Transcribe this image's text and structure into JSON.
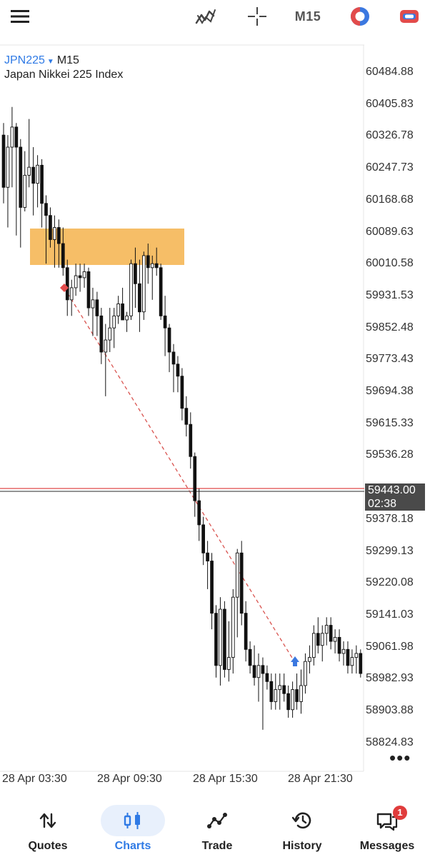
{
  "toolbar": {
    "timeframe": "M15",
    "icons": [
      "hamburger-menu-icon",
      "indicators-icon",
      "crosshair-icon",
      "one-click-trading-icon",
      "trade-toggle-icon"
    ]
  },
  "chart": {
    "symbol": "JPN225",
    "timeframe": "M15",
    "description": "Japan Nikkei 225 Index",
    "price_label": "59443.00",
    "countdown": "02:38",
    "more_label": "•••"
  },
  "colors": {
    "accent": "#2f7ae5",
    "zone": "#f5b95a",
    "trendline": "#d9534f",
    "bid_line": "#e24b4b",
    "ask_line": "#555555"
  },
  "chart_data": {
    "type": "candlestick",
    "y_ticks": [
      "60484.88",
      "60405.83",
      "60326.78",
      "60247.73",
      "60168.68",
      "60089.63",
      "60010.58",
      "59931.53",
      "59852.48",
      "59773.43",
      "59694.38",
      "59615.33",
      "59536.28",
      "59378.18",
      "59299.13",
      "59220.08",
      "59141.03",
      "59061.98",
      "58982.93",
      "58903.88",
      "58824.83"
    ],
    "x_ticks": [
      "28 Apr 03:30",
      "28 Apr 09:30",
      "28 Apr 15:30",
      "28 Apr 21:30"
    ],
    "current_price": 59443.0,
    "candles": [
      [
        60330,
        60360,
        60160,
        60200
      ],
      [
        60200,
        60330,
        60100,
        60300
      ],
      [
        60300,
        60400,
        60200,
        60350
      ],
      [
        60350,
        60360,
        60080,
        60300
      ],
      [
        60300,
        60320,
        60050,
        60150
      ],
      [
        60150,
        60290,
        60140,
        60230
      ],
      [
        60230,
        60370,
        60200,
        60250
      ],
      [
        60250,
        60300,
        60130,
        60210
      ],
      [
        60210,
        60280,
        60150,
        60255
      ],
      [
        60255,
        60270,
        60100,
        60160
      ],
      [
        60160,
        60180,
        60010,
        60130
      ],
      [
        60130,
        60150,
        60050,
        60070
      ],
      [
        60070,
        60130,
        60000,
        60100
      ],
      [
        60100,
        60120,
        60000,
        60060
      ],
      [
        60060,
        60100,
        59980,
        60000
      ],
      [
        60000,
        60020,
        59880,
        59920
      ],
      [
        59920,
        59970,
        59880,
        59950
      ],
      [
        59950,
        60010,
        59930,
        59980
      ],
      [
        59980,
        60010,
        59940,
        59975
      ],
      [
        59975,
        60010,
        59950,
        59990
      ],
      [
        59990,
        60000,
        59880,
        59900
      ],
      [
        59900,
        59950,
        59830,
        59920
      ],
      [
        59920,
        59940,
        59830,
        59880
      ],
      [
        59880,
        59900,
        59760,
        59790
      ],
      [
        59790,
        59860,
        59680,
        59820
      ],
      [
        59820,
        59900,
        59790,
        59850
      ],
      [
        59850,
        59900,
        59800,
        59880
      ],
      [
        59880,
        59930,
        59860,
        59910
      ],
      [
        59910,
        59950,
        59880,
        59870
      ],
      [
        59870,
        59890,
        59840,
        59880
      ],
      [
        59880,
        60020,
        59870,
        60010
      ],
      [
        60010,
        60050,
        59900,
        59960
      ],
      [
        59960,
        60020,
        59840,
        59890
      ],
      [
        59890,
        60040,
        59870,
        60030
      ],
      [
        60030,
        60060,
        59960,
        60000
      ],
      [
        60000,
        60030,
        59920,
        60010
      ],
      [
        60010,
        60050,
        59980,
        60000
      ],
      [
        60000,
        60010,
        59870,
        59880
      ],
      [
        59880,
        59930,
        59780,
        59850
      ],
      [
        59850,
        59860,
        59740,
        59790
      ],
      [
        59790,
        59810,
        59690,
        59760
      ],
      [
        59760,
        59780,
        59690,
        59730
      ],
      [
        59730,
        59750,
        59620,
        59650
      ],
      [
        59650,
        59680,
        59580,
        59610
      ],
      [
        59610,
        59640,
        59500,
        59530
      ],
      [
        59530,
        59540,
        59380,
        59420
      ],
      [
        59420,
        59450,
        59320,
        59360
      ],
      [
        59360,
        59380,
        59260,
        59290
      ],
      [
        59290,
        59320,
        59200,
        59270
      ],
      [
        59270,
        59290,
        59100,
        59140
      ],
      [
        59140,
        59160,
        58980,
        59010
      ],
      [
        59010,
        59180,
        58960,
        59150
      ],
      [
        59150,
        59170,
        58980,
        59000
      ],
      [
        59000,
        59120,
        58970,
        59030
      ],
      [
        59030,
        59200,
        58990,
        59180
      ],
      [
        59180,
        59300,
        59080,
        59290
      ],
      [
        59290,
        59320,
        59110,
        59140
      ],
      [
        59140,
        59170,
        59020,
        59050
      ],
      [
        59050,
        59070,
        58990,
        59010
      ],
      [
        59010,
        59060,
        58960,
        58980
      ],
      [
        58980,
        59040,
        58920,
        59010
      ],
      [
        59010,
        59030,
        58850,
        58990
      ],
      [
        58990,
        59010,
        58950,
        58970
      ],
      [
        58970,
        58990,
        58900,
        58920
      ],
      [
        58920,
        58990,
        58900,
        58950
      ],
      [
        58950,
        58990,
        58900,
        58960
      ],
      [
        58960,
        58990,
        58920,
        58940
      ],
      [
        58940,
        58960,
        58880,
        58900
      ],
      [
        58900,
        58970,
        58880,
        58950
      ],
      [
        58950,
        58990,
        58900,
        58920
      ],
      [
        58920,
        59000,
        58890,
        58960
      ],
      [
        58960,
        59040,
        58940,
        59020
      ],
      [
        59020,
        59060,
        58990,
        59030
      ],
      [
        59030,
        59110,
        59010,
        59090
      ],
      [
        59090,
        59130,
        59040,
        59060
      ],
      [
        59060,
        59110,
        59020,
        59090
      ],
      [
        59090,
        59130,
        59060,
        59110
      ],
      [
        59110,
        59130,
        59050,
        59070
      ],
      [
        59070,
        59100,
        59040,
        59080
      ],
      [
        59080,
        59100,
        59020,
        59040
      ],
      [
        59040,
        59070,
        59010,
        59050
      ],
      [
        59050,
        59070,
        58990,
        59010
      ],
      [
        59010,
        59050,
        58990,
        59030
      ],
      [
        59030,
        59060,
        58990,
        59040
      ],
      [
        59040,
        59050,
        58980,
        58990
      ]
    ]
  },
  "time_axis": {
    "t1": "28 Apr 03:30",
    "t2": "28 Apr 09:30",
    "t3": "28 Apr 15:30",
    "t4": "28 Apr 21:30"
  },
  "nav": {
    "quotes": "Quotes",
    "charts": "Charts",
    "trade": "Trade",
    "history": "History",
    "messages": "Messages",
    "messages_badge": "1"
  }
}
